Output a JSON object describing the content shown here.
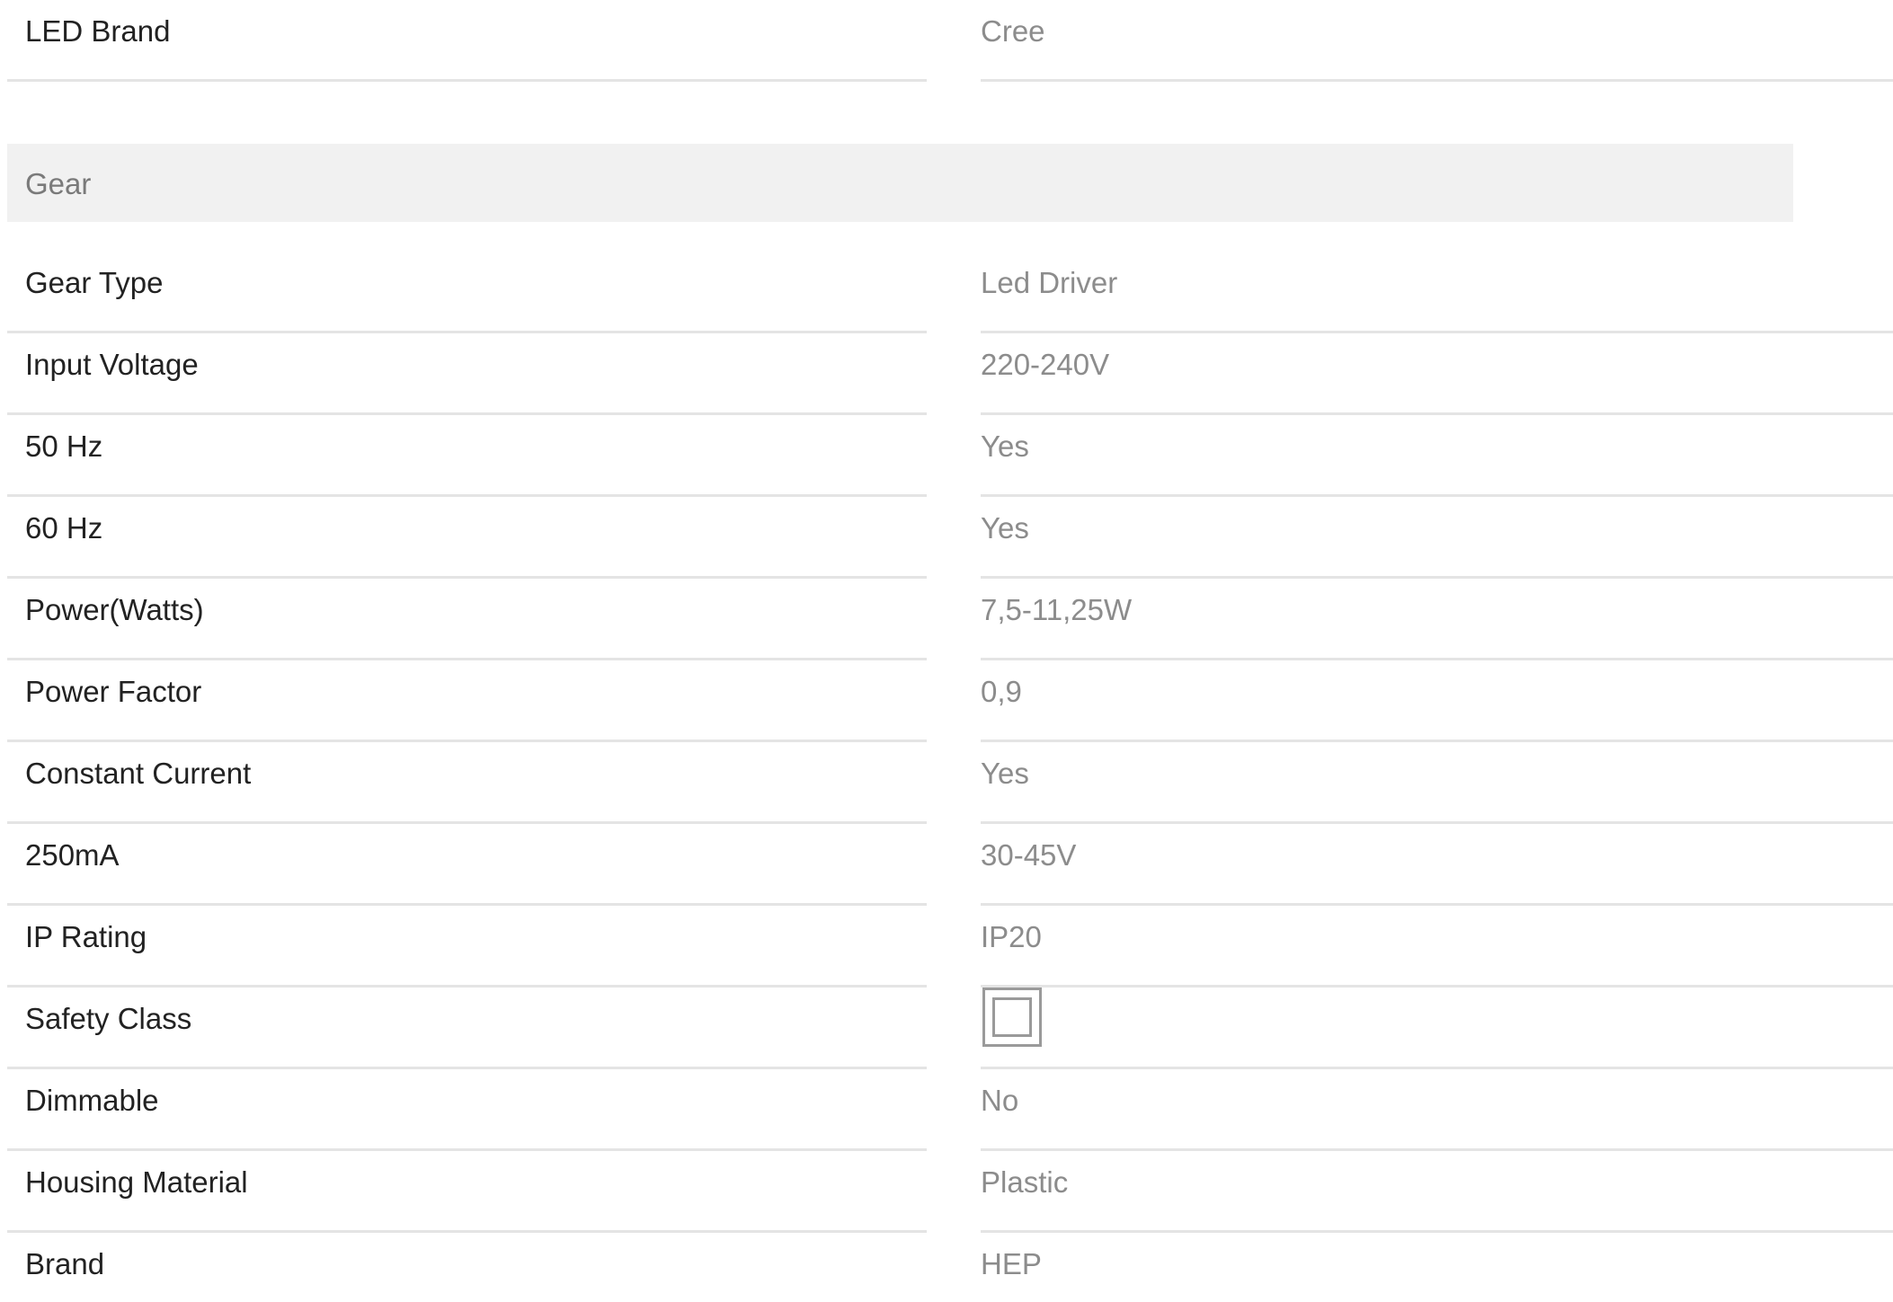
{
  "top_spec": {
    "label": "LED Brand",
    "value": "Cree"
  },
  "section": {
    "title": "Gear"
  },
  "specs": [
    {
      "label": "Gear Type",
      "value": "Led Driver"
    },
    {
      "label": "Input Voltage",
      "value": "220-240V"
    },
    {
      "label": "50 Hz",
      "value": "Yes"
    },
    {
      "label": "60 Hz",
      "value": "Yes"
    },
    {
      "label": "Power(Watts)",
      "value": "7,5-11,25W"
    },
    {
      "label": "Power Factor",
      "value": "0,9"
    },
    {
      "label": "Constant Current",
      "value": "Yes"
    },
    {
      "label": "250mA",
      "value": "30-45V"
    },
    {
      "label": "IP Rating",
      "value": "IP20"
    },
    {
      "label": "Safety Class",
      "value": "",
      "icon": "class-ii-double-square-icon"
    },
    {
      "label": "Dimmable",
      "value": "No"
    },
    {
      "label": "Housing Material",
      "value": "Plastic"
    },
    {
      "label": "Brand",
      "value": "HEP"
    }
  ],
  "colors": {
    "label_text": "#222222",
    "value_text": "#8c8c8c",
    "section_bg": "#f1f1f1",
    "section_text": "#7a7a7a",
    "divider": "#e4e4e4"
  }
}
